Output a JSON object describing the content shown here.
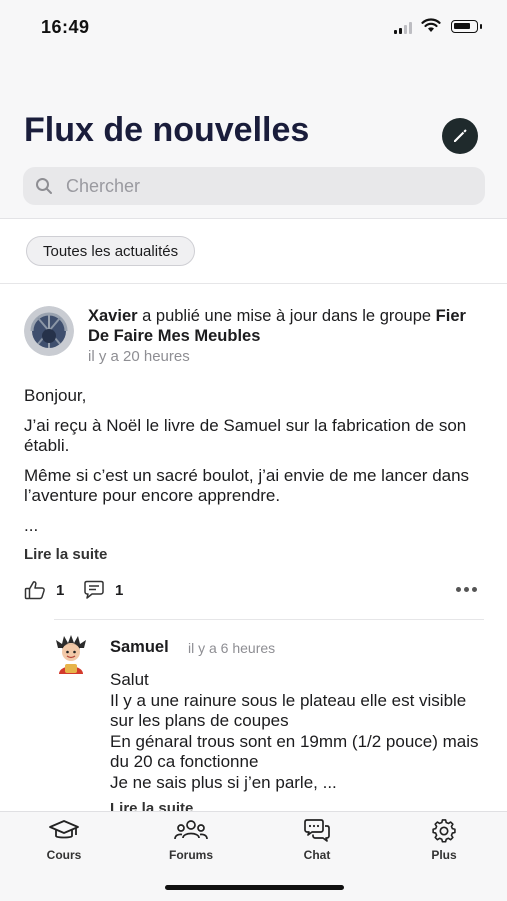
{
  "status_bar": {
    "time": "16:49"
  },
  "header": {
    "title": "Flux de nouvelles",
    "search_placeholder": "Chercher"
  },
  "filter": {
    "label": "Toutes les actualités"
  },
  "post": {
    "author": "Xavier",
    "action_text": " a publié une mise à jour dans le groupe ",
    "group": "Fier De Faire Mes Meubles",
    "time": "il y a 20 heures",
    "paragraphs": [
      "Bonjour,",
      "J’ai reçu à Noël le livre de Samuel sur la fabrication de son établi.",
      "Même si c’est un sacré boulot, j’ai envie de me lancer dans l’aventure pour encore apprendre.",
      "..."
    ],
    "read_more": "Lire la suite",
    "likes": "1",
    "comments": "1"
  },
  "comment": {
    "author": "Samuel",
    "time": "il y a 6 heures",
    "lines": [
      "Salut",
      "Il y a une rainure sous le plateau elle est visible sur les  plans de coupes",
      "En génaral trous sont en 19mm (1/2 pouce) mais du 20 ca fonctionne",
      "Je ne sais plus si j’en parle, ..."
    ],
    "read_more": "Lire la suite"
  },
  "tabbar": {
    "tabs": [
      {
        "label": "Cours",
        "icon": "graduation-cap-icon"
      },
      {
        "label": "Forums",
        "icon": "users-icon"
      },
      {
        "label": "Chat",
        "icon": "chat-bubbles-icon"
      },
      {
        "label": "Plus",
        "icon": "gear-icon"
      }
    ]
  }
}
